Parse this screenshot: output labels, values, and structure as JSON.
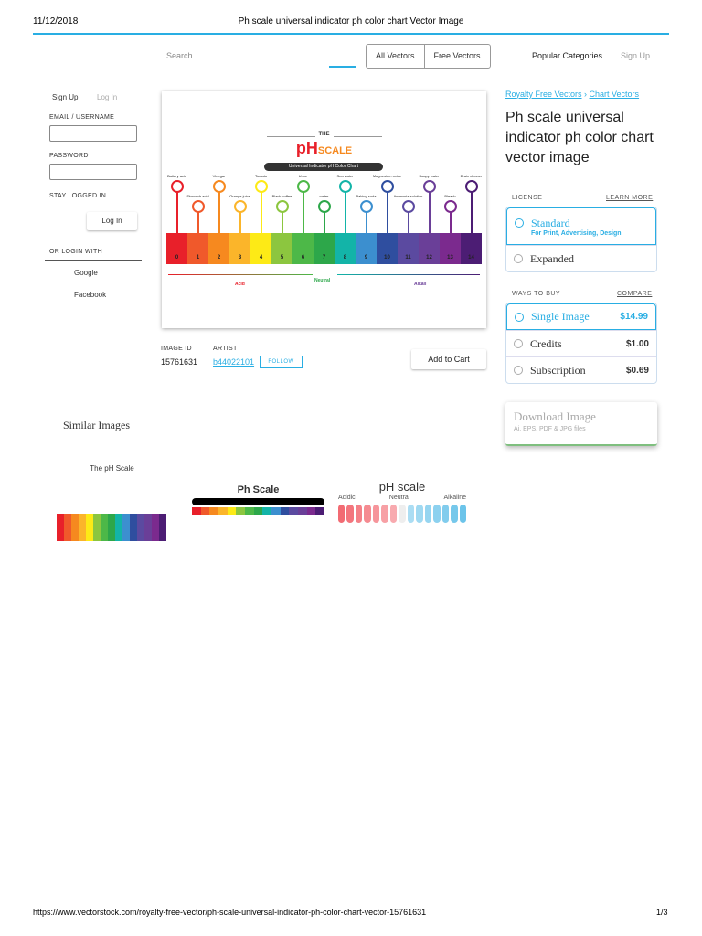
{
  "print_header": {
    "date": "11/12/2018",
    "title": "Ph scale universal indicator ph color chart Vector Image"
  },
  "nav": {
    "search_placeholder": "Search...",
    "all_vectors": "All Vectors",
    "free_vectors": "Free Vectors",
    "popular": "Popular Categories",
    "signup": "Sign Up"
  },
  "login": {
    "signup": "Sign Up",
    "login_tab": "Log In",
    "email_label": "EMAIL / USERNAME",
    "password_label": "PASSWORD",
    "stay": "STAY LOGGED IN",
    "login_btn": "Log In",
    "or": "OR LOGIN WITH",
    "google": "Google",
    "facebook": "Facebook"
  },
  "breadcrumb": [
    "Royalty Free Vectors",
    "Chart Vectors"
  ],
  "title": "Ph scale universal indicator ph color chart vector image",
  "preview": {
    "the": "THE",
    "ph": "pH",
    "scale": "SCALE",
    "subtitle": "Universal Indicator pH Color Chart",
    "acid": "Acid",
    "neutral": "Neutral",
    "alkali": "Alkali",
    "items": [
      "Battery acid",
      "Stomach acid",
      "Vinegar",
      "Orange juice",
      "Tomato",
      "Black coffee",
      "Urine",
      "water",
      "Sea water",
      "Baking soda",
      "Magnesium oxide",
      "Ammonia solution",
      "Soapy water",
      "Bleach",
      "Drain cleaner"
    ],
    "colors": [
      "#e8202a",
      "#f0592b",
      "#f6891f",
      "#fbb52a",
      "#fdea16",
      "#8cc63f",
      "#4db848",
      "#2da74a",
      "#13b4a8",
      "#3c8fcf",
      "#2f4e9f",
      "#5b4aa0",
      "#6a3f98",
      "#7b2a8e",
      "#4c1d74"
    ],
    "numbers": [
      "0",
      "1",
      "2",
      "3",
      "4",
      "5",
      "6",
      "7",
      "8",
      "9",
      "10",
      "11",
      "12",
      "13",
      "14"
    ]
  },
  "meta": {
    "image_id_label": "IMAGE ID",
    "image_id": "15761631",
    "artist_label": "ARTIST",
    "artist": "b44022101",
    "follow": "FOLLOW",
    "add_to_cart": "Add to Cart"
  },
  "license": {
    "label": "LICENSE",
    "learn_more": "LEARN MORE",
    "standard": "Standard",
    "standard_sub": "For Print, Advertising, Design",
    "expanded": "Expanded"
  },
  "buy": {
    "label": "WAYS TO BUY",
    "compare": "COMPARE",
    "options": [
      {
        "name": "Single Image",
        "price": "$14.99"
      },
      {
        "name": "Credits",
        "price": "$1.00"
      },
      {
        "name": "Subscription",
        "price": "$0.69"
      }
    ]
  },
  "download": {
    "title": "Download Image",
    "sub": "Ai, EPS, PDF & JPG files"
  },
  "similar": {
    "heading": "Similar Images",
    "t1": "The pH Scale",
    "t2": "Ph Scale",
    "t3": "pH scale",
    "t3_acidic": "Acidic",
    "t3_neutral": "Neutral",
    "t3_alkaline": "Alkaline"
  },
  "footer": {
    "url": "https://www.vectorstock.com/royalty-free-vector/ph-scale-universal-indicator-ph-color-chart-vector-15761631",
    "page": "1/3"
  }
}
